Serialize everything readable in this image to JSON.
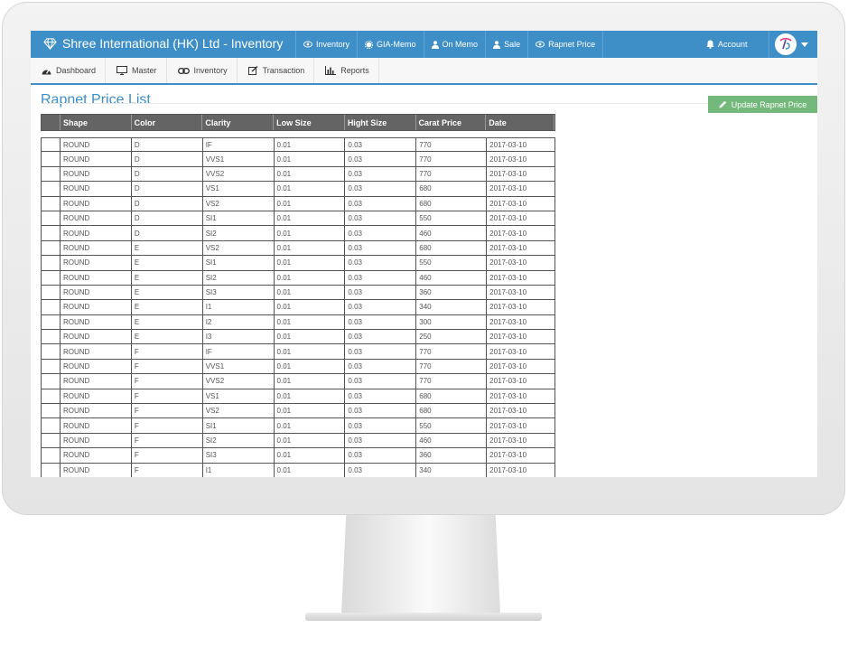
{
  "brand": {
    "title": "Shree International (HK) Ltd - Inventory"
  },
  "topnav": {
    "items": [
      {
        "label": "Inventory",
        "icon": "eye-icon"
      },
      {
        "label": "GIA-Memo",
        "icon": "gear-icon"
      },
      {
        "label": "On Memo",
        "icon": "user-icon"
      },
      {
        "label": "Sale",
        "icon": "users-icon"
      },
      {
        "label": "Rapnet Price",
        "icon": "eye-icon"
      }
    ],
    "account_label": "Account"
  },
  "subnav": {
    "items": [
      {
        "label": "Dashboard",
        "icon": "dashboard-icon"
      },
      {
        "label": "Master",
        "icon": "monitor-icon"
      },
      {
        "label": "Inventory",
        "icon": "link-icon"
      },
      {
        "label": "Transaction",
        "icon": "edit-icon"
      },
      {
        "label": "Reports",
        "icon": "bar-chart-icon"
      }
    ]
  },
  "page": {
    "title": "Rapnet Price List",
    "update_button": "Update Rapnet Price"
  },
  "colors": {
    "primary": "#3e8ec8",
    "button_green": "#74b97b",
    "header_gray": "#646464"
  },
  "table": {
    "columns": [
      "",
      "Shape",
      "Color",
      "Clarity",
      "Low Size",
      "Hight Size",
      "Carat Price",
      "Date"
    ],
    "rows": [
      [
        "ROUND",
        "D",
        "IF",
        "0.01",
        "0.03",
        "770",
        "2017-03-10"
      ],
      [
        "ROUND",
        "D",
        "VVS1",
        "0.01",
        "0.03",
        "770",
        "2017-03-10"
      ],
      [
        "ROUND",
        "D",
        "VVS2",
        "0.01",
        "0.03",
        "770",
        "2017-03-10"
      ],
      [
        "ROUND",
        "D",
        "VS1",
        "0.01",
        "0.03",
        "680",
        "2017-03-10"
      ],
      [
        "ROUND",
        "D",
        "VS2",
        "0.01",
        "0.03",
        "680",
        "2017-03-10"
      ],
      [
        "ROUND",
        "D",
        "SI1",
        "0.01",
        "0.03",
        "550",
        "2017-03-10"
      ],
      [
        "ROUND",
        "D",
        "SI2",
        "0.01",
        "0.03",
        "460",
        "2017-03-10"
      ],
      [
        "ROUND",
        "E",
        "VS2",
        "0.01",
        "0.03",
        "680",
        "2017-03-10"
      ],
      [
        "ROUND",
        "E",
        "SI1",
        "0.01",
        "0.03",
        "550",
        "2017-03-10"
      ],
      [
        "ROUND",
        "E",
        "SI2",
        "0.01",
        "0.03",
        "460",
        "2017-03-10"
      ],
      [
        "ROUND",
        "E",
        "SI3",
        "0.01",
        "0.03",
        "360",
        "2017-03-10"
      ],
      [
        "ROUND",
        "E",
        "I1",
        "0.01",
        "0.03",
        "340",
        "2017-03-10"
      ],
      [
        "ROUND",
        "E",
        "I2",
        "0.01",
        "0.03",
        "300",
        "2017-03-10"
      ],
      [
        "ROUND",
        "E",
        "I3",
        "0.01",
        "0.03",
        "250",
        "2017-03-10"
      ],
      [
        "ROUND",
        "F",
        "IF",
        "0.01",
        "0.03",
        "770",
        "2017-03-10"
      ],
      [
        "ROUND",
        "F",
        "VVS1",
        "0.01",
        "0.03",
        "770",
        "2017-03-10"
      ],
      [
        "ROUND",
        "F",
        "VVS2",
        "0.01",
        "0.03",
        "770",
        "2017-03-10"
      ],
      [
        "ROUND",
        "F",
        "VS1",
        "0.01",
        "0.03",
        "680",
        "2017-03-10"
      ],
      [
        "ROUND",
        "F",
        "VS2",
        "0.01",
        "0.03",
        "680",
        "2017-03-10"
      ],
      [
        "ROUND",
        "F",
        "SI1",
        "0.01",
        "0.03",
        "550",
        "2017-03-10"
      ],
      [
        "ROUND",
        "F",
        "SI2",
        "0.01",
        "0.03",
        "460",
        "2017-03-10"
      ],
      [
        "ROUND",
        "F",
        "SI3",
        "0.01",
        "0.03",
        "360",
        "2017-03-10"
      ],
      [
        "ROUND",
        "F",
        "I1",
        "0.01",
        "0.03",
        "340",
        "2017-03-10"
      ]
    ]
  }
}
